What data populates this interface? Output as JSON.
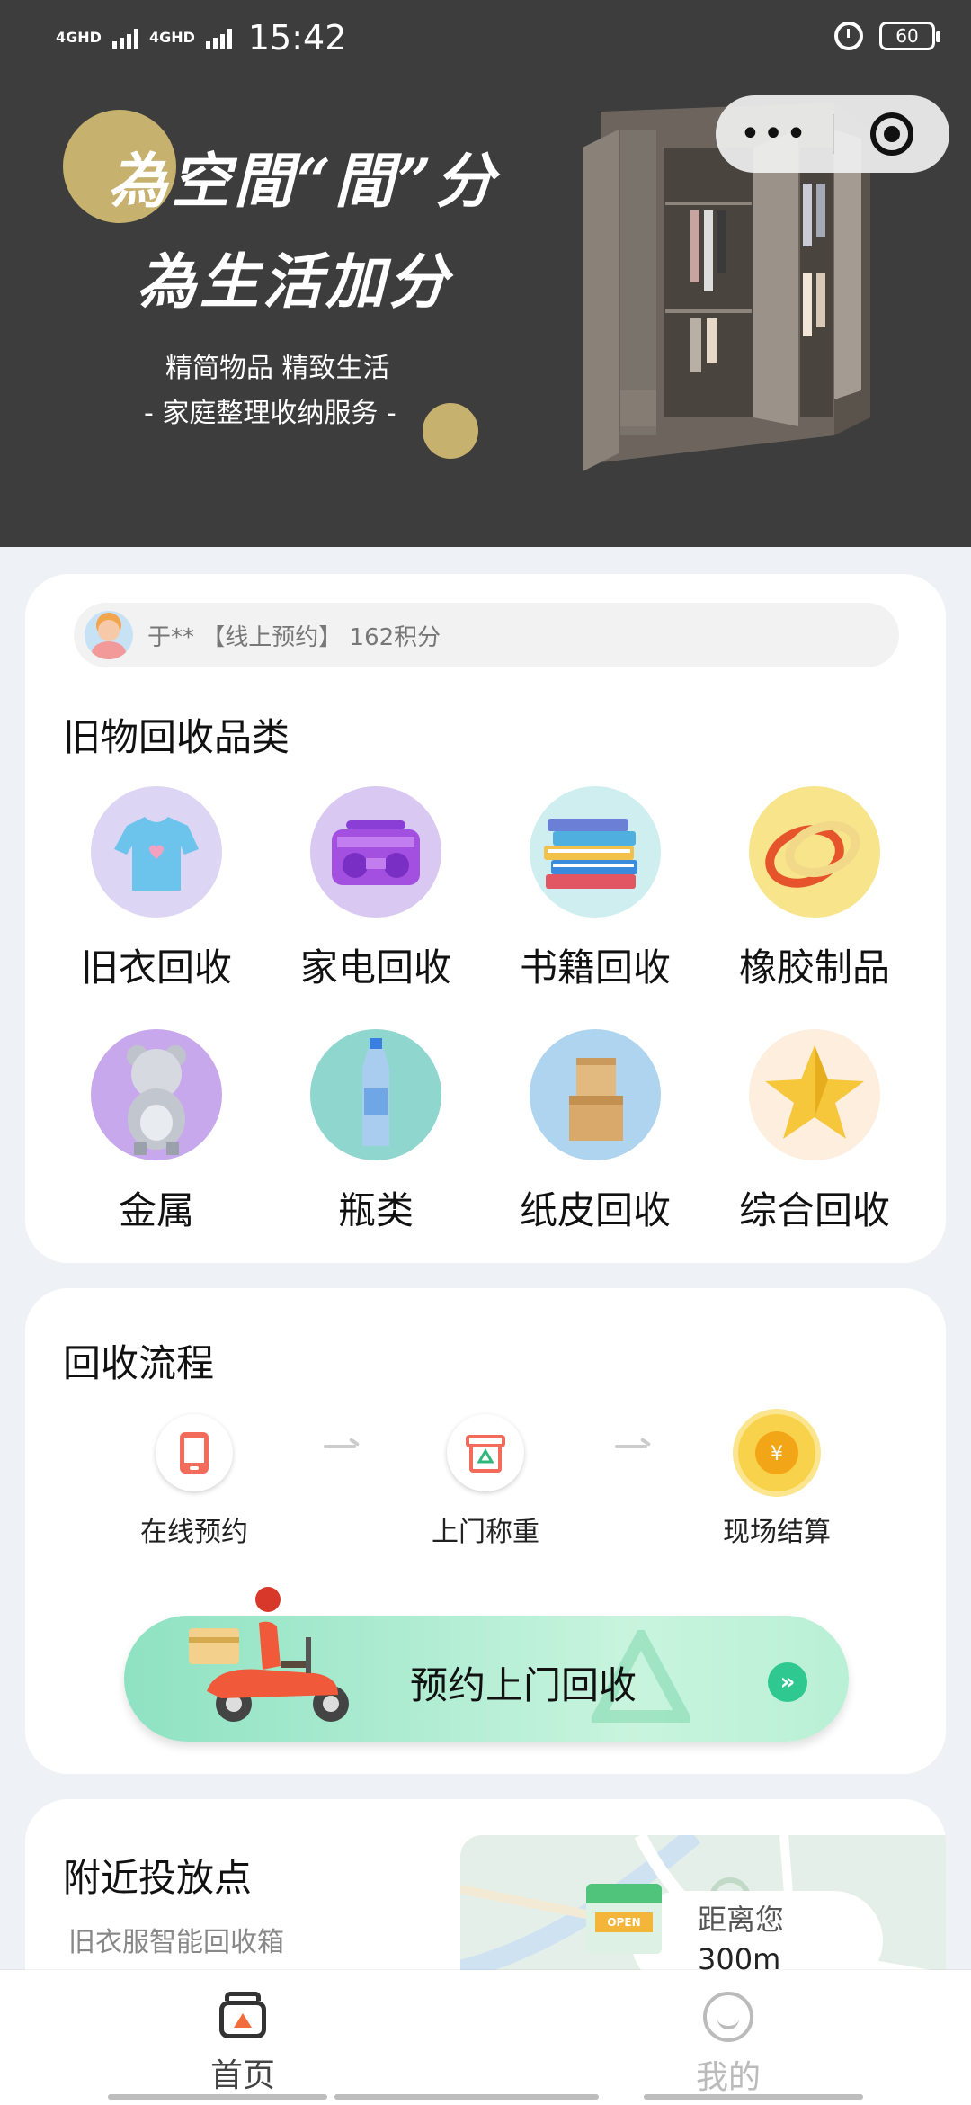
{
  "status_bar": {
    "network1": "4GHD",
    "network2": "4GHD",
    "time": "15:42",
    "battery": "60"
  },
  "mini_program": {
    "more_label": "•••"
  },
  "banner": {
    "slogan_line1": "為空間“間”分",
    "slogan_line2": "為生活加分",
    "sub_line1": "精简物品  精致生活",
    "sub_line2": "- 家庭整理收纳服务 -"
  },
  "ticker": {
    "text": "于** 【线上预约】 162积分"
  },
  "categories": {
    "title": "旧物回收品类",
    "items": [
      {
        "label": "旧衣回收",
        "icon": "tshirt-icon"
      },
      {
        "label": "家电回收",
        "icon": "radio-icon"
      },
      {
        "label": "书籍回收",
        "icon": "books-icon"
      },
      {
        "label": "橡胶制品",
        "icon": "rubber-band-icon"
      },
      {
        "label": "金属",
        "icon": "metal-bear-icon"
      },
      {
        "label": "瓶类",
        "icon": "bottle-icon"
      },
      {
        "label": "纸皮回收",
        "icon": "cardboard-box-icon"
      },
      {
        "label": "综合回收",
        "icon": "star-icon"
      }
    ]
  },
  "process": {
    "title": "回收流程",
    "steps": [
      {
        "label": "在线预约",
        "icon": "phone-icon"
      },
      {
        "label": "上门称重",
        "icon": "recycle-bin-icon"
      },
      {
        "label": "现场结算",
        "icon": "coin-icon"
      }
    ],
    "coin_symbol": "¥",
    "book_button": "预约上门回收",
    "book_arrow": "»"
  },
  "nearby": {
    "title": "附近投放点",
    "sub1": "旧衣服智能回收箱",
    "sub2": "",
    "distance_label": "距离您",
    "distance_value": "300m",
    "box_badge": "OPEN"
  },
  "tabbar": {
    "home_label": "首页",
    "me_label": "我的"
  },
  "colors": {
    "accent_green": "#2fc890",
    "gold": "#c7b16f",
    "banner_bg": "#3d3d3d"
  }
}
